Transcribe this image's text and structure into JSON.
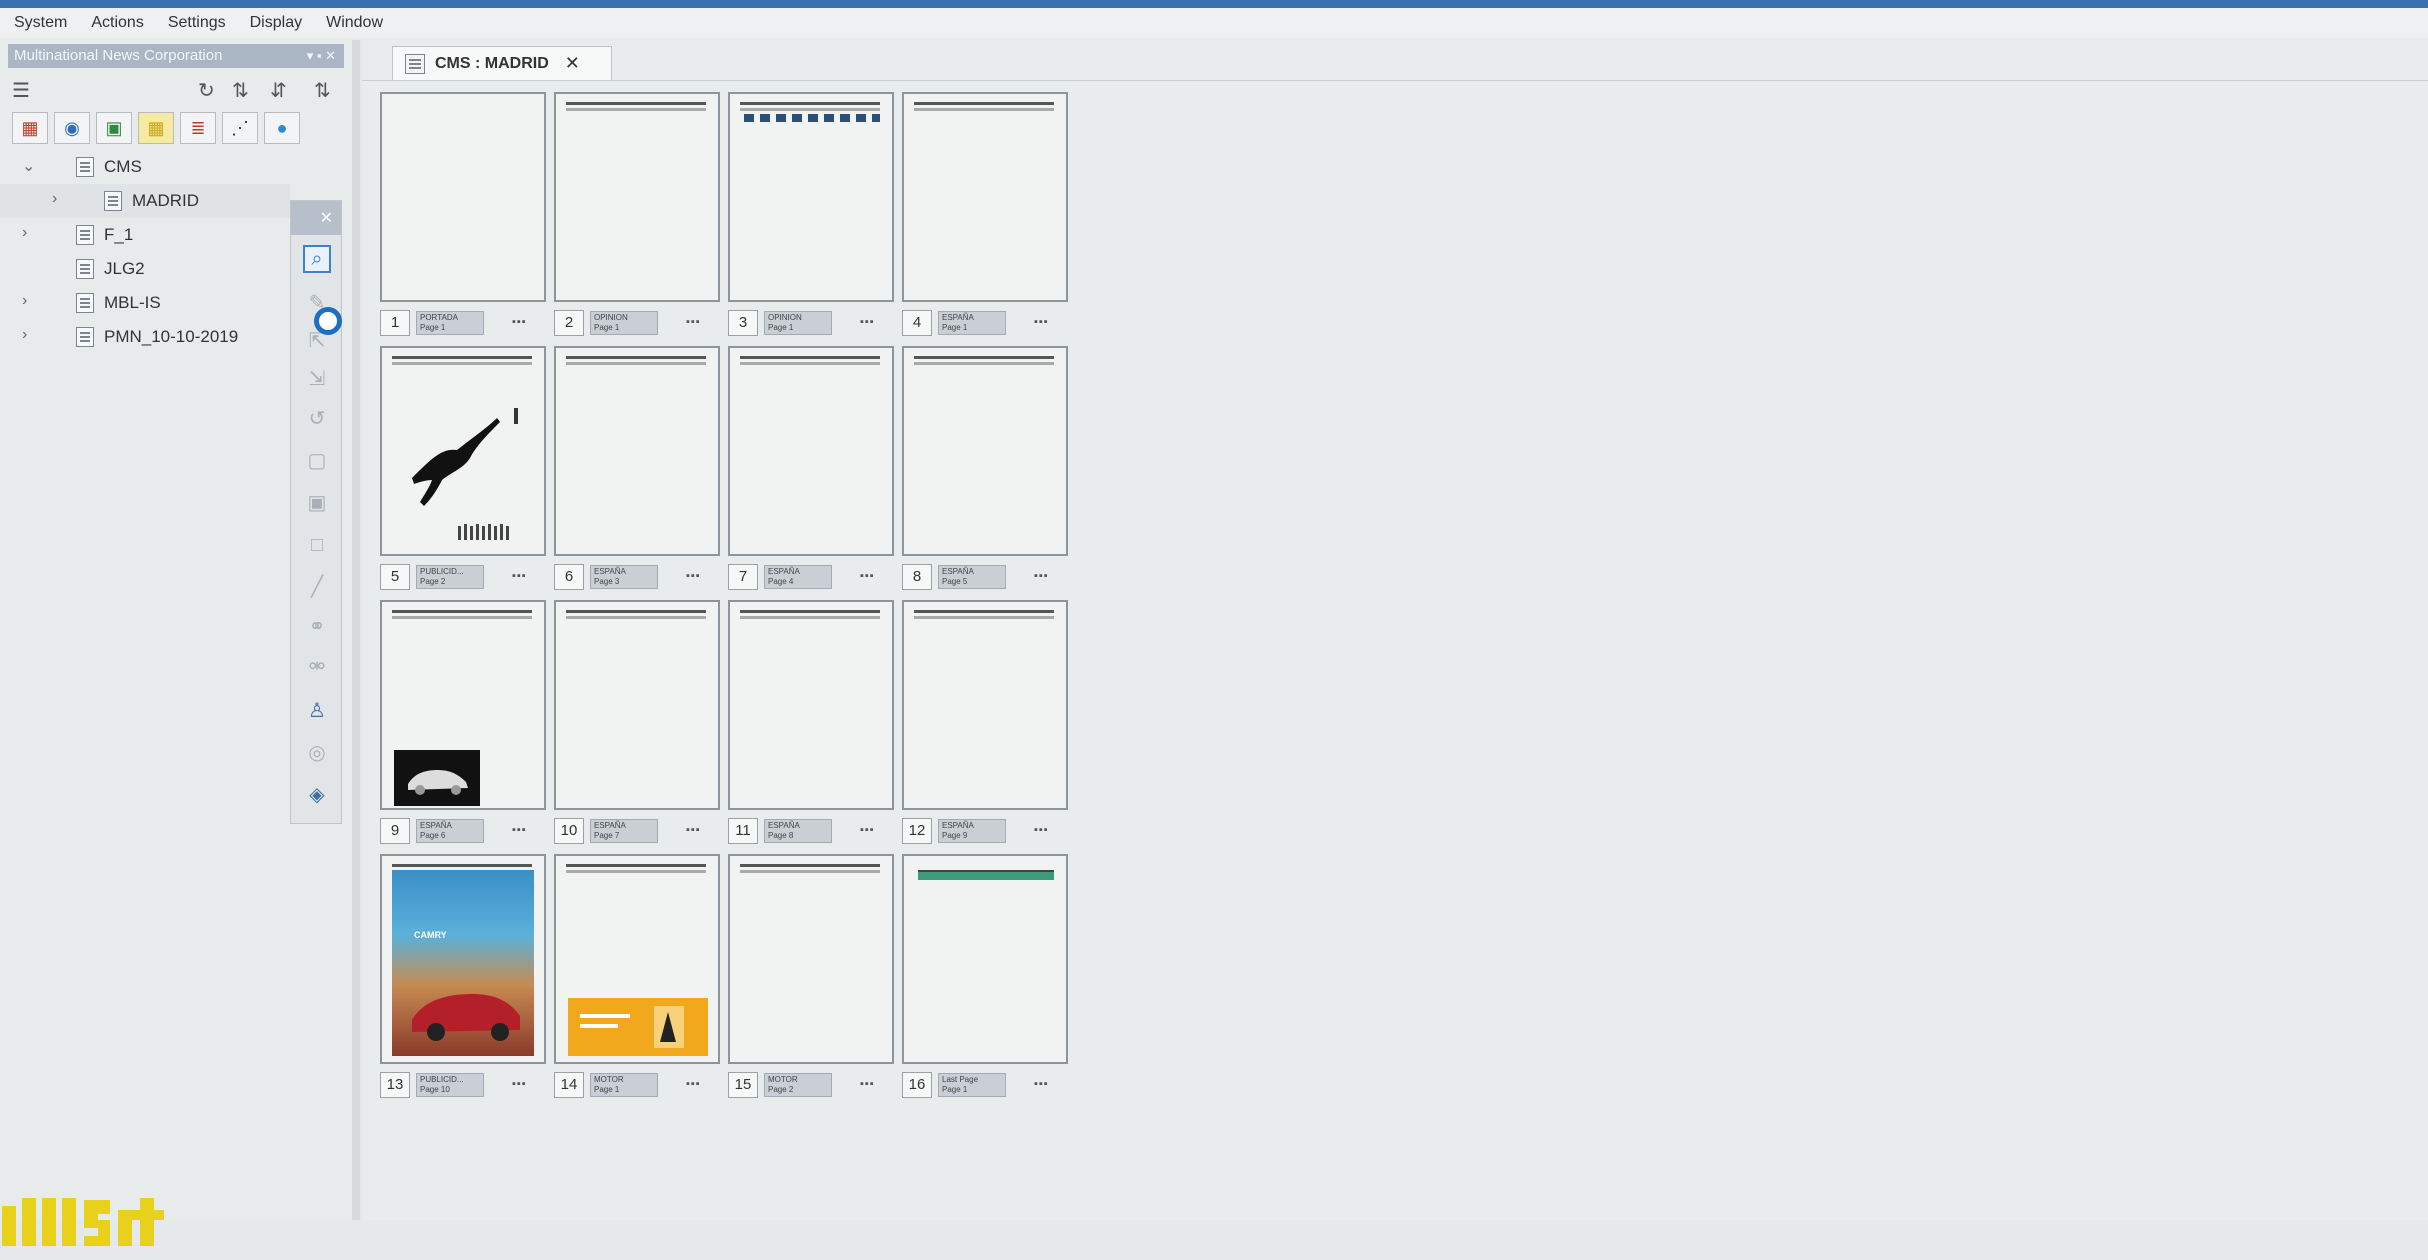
{
  "menu": [
    "System",
    "Actions",
    "Settings",
    "Display",
    "Window"
  ],
  "panel": {
    "title": "Multinational News Corporation",
    "title_buttons": "▾ ▪ ✕"
  },
  "tree": [
    {
      "label": "CMS",
      "expanded": true,
      "level": 0
    },
    {
      "label": "MADRID",
      "expanded": false,
      "level": 1,
      "selected": true
    },
    {
      "label": "F_1",
      "expanded": false,
      "level": 0
    },
    {
      "label": "JLG2",
      "expanded": false,
      "level": 0
    },
    {
      "label": "MBL-IS",
      "expanded": false,
      "level": 0
    },
    {
      "label": "PMN_10-10-2019",
      "expanded": false,
      "level": 0
    }
  ],
  "tab": {
    "label": "CMS : MADRID",
    "close": "✕"
  },
  "pages": [
    {
      "num": "1",
      "name": "PORTADA",
      "sub": "Page 1",
      "status": "▪▪▪"
    },
    {
      "num": "2",
      "name": "OPINION",
      "sub": "Page 1",
      "status": "▪▪▪"
    },
    {
      "num": "3",
      "name": "OPINION",
      "sub": "Page 1",
      "status": "▪▪▪"
    },
    {
      "num": "4",
      "name": "ESPAÑA",
      "sub": "Page 1",
      "status": "▪▪▪"
    },
    {
      "num": "5",
      "name": "PUBLICID...",
      "sub": "Page 2",
      "status": "▪▪▪"
    },
    {
      "num": "6",
      "name": "ESPAÑA",
      "sub": "Page 3",
      "status": "▪▪▪"
    },
    {
      "num": "7",
      "name": "ESPAÑA",
      "sub": "Page 4",
      "status": "▪▪▪"
    },
    {
      "num": "8",
      "name": "ESPAÑA",
      "sub": "Page 5",
      "status": "▪▪▪"
    },
    {
      "num": "9",
      "name": "ESPAÑA",
      "sub": "Page 6",
      "status": "▪▪▪"
    },
    {
      "num": "10",
      "name": "ESPAÑA",
      "sub": "Page 7",
      "status": "▪▪▪"
    },
    {
      "num": "11",
      "name": "ESPAÑA",
      "sub": "Page 8",
      "status": "▪▪▪"
    },
    {
      "num": "12",
      "name": "ESPAÑA",
      "sub": "Page 9",
      "status": "▪▪▪"
    },
    {
      "num": "13",
      "name": "PUBLICID...",
      "sub": "Page 10",
      "status": "▪▪▪"
    },
    {
      "num": "14",
      "name": "MOTOR",
      "sub": "Page 1",
      "status": "▪▪▪"
    },
    {
      "num": "15",
      "name": "MOTOR",
      "sub": "Page 2",
      "status": "▪▪▪"
    },
    {
      "num": "16",
      "name": "Last Page",
      "sub": "Page 1",
      "status": "▪▪▪"
    }
  ],
  "ad_text": "CAMRY",
  "colors": {
    "accent": "#3f82c8",
    "topbar": "#3a6fb0",
    "logo": "#e8d11a"
  }
}
